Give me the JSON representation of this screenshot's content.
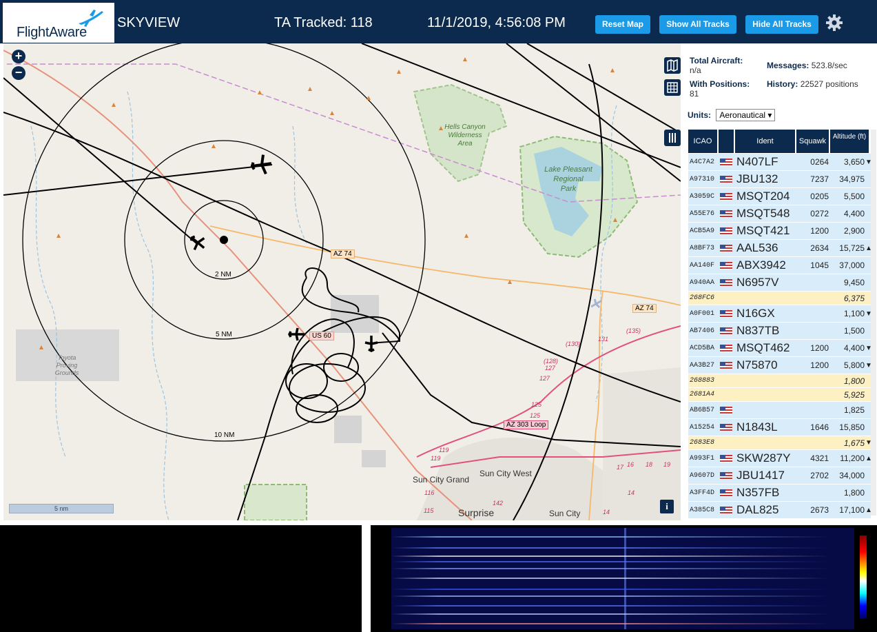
{
  "header": {
    "logo_text": "FlightAware",
    "site_name": "SKYVIEW",
    "tracked": "TA Tracked: 118",
    "datetime": "11/1/2019, 4:56:08 PM",
    "buttons": {
      "reset": "Reset Map",
      "show_all": "Show All Tracks",
      "hide_all": "Hide All Tracks"
    },
    "settings_icon": "gear-icon"
  },
  "map": {
    "zoom_in": "+",
    "zoom_out": "−",
    "scale_bar": "5 nm",
    "info": "i",
    "range_rings": [
      "2 NM",
      "5 NM",
      "10 NM"
    ],
    "road_labels": [
      "AZ 74",
      "AZ 74",
      "US 60",
      "AZ 303 Loop",
      "(130)",
      "131",
      "(135)",
      "(128)",
      "127",
      "127",
      "125",
      "125",
      "119",
      "119",
      "116",
      "115",
      "142",
      "17",
      "16",
      "18",
      "19",
      "14",
      "14"
    ],
    "place_labels": {
      "hells_canyon": [
        "Hells Canyon",
        "Wilderness",
        "Area"
      ],
      "lake_pleasant": [
        "Lake Pleasant",
        "Regional",
        "Park"
      ],
      "toyota": [
        "Toyota",
        "Proving",
        "Grounds"
      ],
      "sun_city_grand": "Sun City Grand",
      "sun_city_west": "Sun City West",
      "surprise": "Surprise",
      "sun_city": "Sun City"
    }
  },
  "stats": {
    "total_label": "Total Aircraft:",
    "total_value": "n/a",
    "positions_label": "With Positions:",
    "positions_value": "81",
    "messages_label": "Messages:",
    "messages_value": "523.8/sec",
    "history_label": "History:",
    "history_value": "22527 positions"
  },
  "units": {
    "label": "Units:",
    "value": "Aeronautical"
  },
  "table": {
    "columns": [
      "ICAO",
      "",
      "Ident",
      "Squawk",
      "Altitude (ft)"
    ],
    "rows": [
      {
        "icao": "A4C7A2",
        "flag": true,
        "ident": "N407LF",
        "squawk": "0264",
        "alt": "3,650",
        "trend": "▼",
        "alt_row": false
      },
      {
        "icao": "A97310",
        "flag": true,
        "ident": "JBU132",
        "squawk": "7237",
        "alt": "34,975",
        "trend": "",
        "alt_row": false
      },
      {
        "icao": "A3059C",
        "flag": true,
        "ident": "MSQT204",
        "squawk": "0205",
        "alt": "5,500",
        "trend": "",
        "alt_row": false
      },
      {
        "icao": "A55E76",
        "flag": true,
        "ident": "MSQT548",
        "squawk": "0272",
        "alt": "4,400",
        "trend": "",
        "alt_row": false
      },
      {
        "icao": "ACB5A9",
        "flag": true,
        "ident": "MSQT421",
        "squawk": "1200",
        "alt": "2,900",
        "trend": "",
        "alt_row": false
      },
      {
        "icao": "A8BF73",
        "flag": true,
        "ident": "AAL536",
        "squawk": "2634",
        "alt": "15,725",
        "trend": "▲",
        "alt_row": false
      },
      {
        "icao": "AA140F",
        "flag": true,
        "ident": "ABX3942",
        "squawk": "1045",
        "alt": "37,000",
        "trend": "",
        "alt_row": false
      },
      {
        "icao": "A940AA",
        "flag": true,
        "ident": "N6957V",
        "squawk": "",
        "alt": "9,450",
        "trend": "",
        "alt_row": false
      },
      {
        "icao": "268FC6",
        "flag": false,
        "ident": "",
        "squawk": "",
        "alt": "6,375",
        "trend": "",
        "alt_row": true
      },
      {
        "icao": "A0F001",
        "flag": true,
        "ident": "N16GX",
        "squawk": "",
        "alt": "1,100",
        "trend": "▼",
        "alt_row": false
      },
      {
        "icao": "AB7406",
        "flag": true,
        "ident": "N837TB",
        "squawk": "",
        "alt": "1,500",
        "trend": "",
        "alt_row": false
      },
      {
        "icao": "ACD5BA",
        "flag": true,
        "ident": "MSQT462",
        "squawk": "1200",
        "alt": "4,400",
        "trend": "▼",
        "alt_row": false
      },
      {
        "icao": "AA3B27",
        "flag": true,
        "ident": "N75870",
        "squawk": "1200",
        "alt": "5,800",
        "trend": "▼",
        "alt_row": false
      },
      {
        "icao": "268883",
        "flag": false,
        "ident": "",
        "squawk": "",
        "alt": "1,800",
        "trend": "",
        "alt_row": true
      },
      {
        "icao": "2681A4",
        "flag": false,
        "ident": "",
        "squawk": "",
        "alt": "5,925",
        "trend": "",
        "alt_row": true
      },
      {
        "icao": "AB6B57",
        "flag": true,
        "ident": "",
        "squawk": "",
        "alt": "1,825",
        "trend": "",
        "alt_row": false
      },
      {
        "icao": "A15254",
        "flag": true,
        "ident": "N1843L",
        "squawk": "1646",
        "alt": "15,850",
        "trend": "",
        "alt_row": false
      },
      {
        "icao": "2683E8",
        "flag": false,
        "ident": "",
        "squawk": "",
        "alt": "1,675",
        "trend": "▼",
        "alt_row": true
      },
      {
        "icao": "A993F1",
        "flag": true,
        "ident": "SKW287Y",
        "squawk": "4321",
        "alt": "11,200",
        "trend": "▲",
        "alt_row": false
      },
      {
        "icao": "A9607D",
        "flag": true,
        "ident": "JBU1417",
        "squawk": "2702",
        "alt": "34,000",
        "trend": "",
        "alt_row": false
      },
      {
        "icao": "A3FF4D",
        "flag": true,
        "ident": "N357FB",
        "squawk": "",
        "alt": "1,800",
        "trend": "",
        "alt_row": false
      },
      {
        "icao": "A385C8",
        "flag": true,
        "ident": "DAL825",
        "squawk": "2673",
        "alt": "17,100",
        "trend": "▲",
        "alt_row": false
      }
    ]
  }
}
